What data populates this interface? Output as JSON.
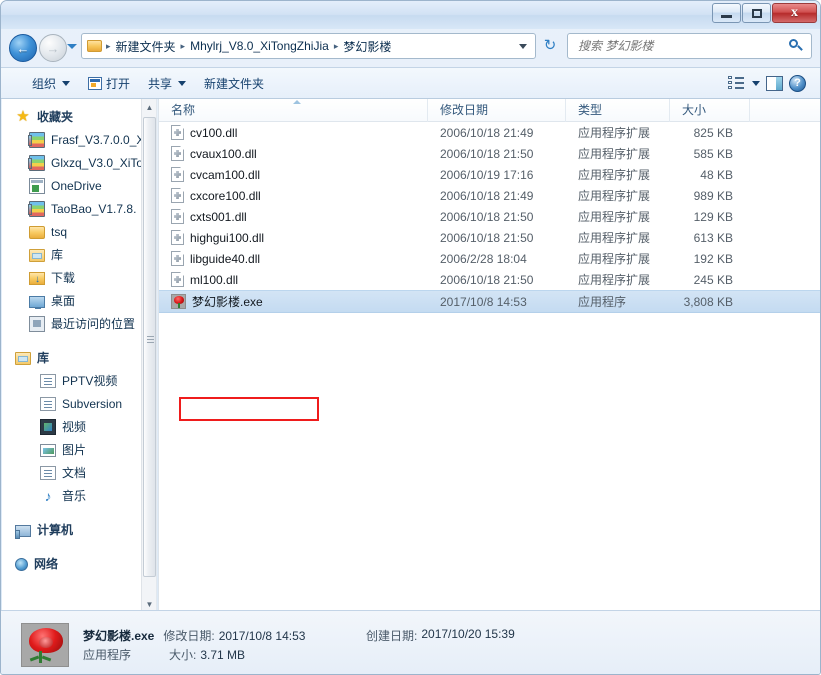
{
  "window": {
    "controls": {
      "minimize": "–",
      "maximize": "□",
      "close": "x"
    }
  },
  "nav": {
    "back_label": "←",
    "forward_label": "→",
    "refresh_label": "↻",
    "breadcrumbs": [
      "新建文件夹",
      "Mhylrj_V8.0_XiTongZhiJia",
      "梦幻影楼"
    ],
    "separator": "▸"
  },
  "search": {
    "placeholder": "搜索 梦幻影楼",
    "value": ""
  },
  "toolbar": {
    "organize": "组织",
    "open": "打开",
    "share": "共享",
    "new_folder": "新建文件夹",
    "help": "?"
  },
  "sidebar": {
    "favorites_title": "收藏夹",
    "favorites": [
      {
        "label": "Frasf_V3.7.0.0_X",
        "icon": "archive-icon"
      },
      {
        "label": "Glxzq_V3.0_XiTo",
        "icon": "archive-icon"
      },
      {
        "label": "OneDrive",
        "icon": "onedrive-icon"
      },
      {
        "label": "TaoBao_V1.7.8.",
        "icon": "archive-icon"
      },
      {
        "label": "tsq",
        "icon": "folder-icon"
      },
      {
        "label": "库",
        "icon": "library-icon"
      },
      {
        "label": "下载",
        "icon": "downloads-icon"
      },
      {
        "label": "桌面",
        "icon": "desktop-icon"
      },
      {
        "label": "最近访问的位置",
        "icon": "recent-places-icon"
      }
    ],
    "libraries_title": "库",
    "libraries": [
      {
        "label": "PPTV视频",
        "icon": "document-icon"
      },
      {
        "label": "Subversion",
        "icon": "document-icon"
      },
      {
        "label": "视频",
        "icon": "video-icon"
      },
      {
        "label": "图片",
        "icon": "picture-icon"
      },
      {
        "label": "文档",
        "icon": "document-icon"
      },
      {
        "label": "音乐",
        "icon": "music-icon"
      }
    ],
    "computer_title": "计算机",
    "network_title": "网络"
  },
  "filelist": {
    "columns": [
      "名称",
      "修改日期",
      "类型",
      "大小"
    ],
    "sorted_column": 0,
    "sort_direction": "asc",
    "rows": [
      {
        "name": "cv100.dll",
        "date": "2006/10/18 21:49",
        "type": "应用程序扩展",
        "size": "825 KB",
        "icon": "dll-icon",
        "selected": false
      },
      {
        "name": "cvaux100.dll",
        "date": "2006/10/18 21:50",
        "type": "应用程序扩展",
        "size": "585 KB",
        "icon": "dll-icon",
        "selected": false
      },
      {
        "name": "cvcam100.dll",
        "date": "2006/10/19 17:16",
        "type": "应用程序扩展",
        "size": "48 KB",
        "icon": "dll-icon",
        "selected": false
      },
      {
        "name": "cxcore100.dll",
        "date": "2006/10/18 21:49",
        "type": "应用程序扩展",
        "size": "989 KB",
        "icon": "dll-icon",
        "selected": false
      },
      {
        "name": "cxts001.dll",
        "date": "2006/10/18 21:50",
        "type": "应用程序扩展",
        "size": "129 KB",
        "icon": "dll-icon",
        "selected": false
      },
      {
        "name": "highgui100.dll",
        "date": "2006/10/18 21:50",
        "type": "应用程序扩展",
        "size": "613 KB",
        "icon": "dll-icon",
        "selected": false
      },
      {
        "name": "libguide40.dll",
        "date": "2006/2/28 18:04",
        "type": "应用程序扩展",
        "size": "192 KB",
        "icon": "dll-icon",
        "selected": false
      },
      {
        "name": "ml100.dll",
        "date": "2006/10/18 21:50",
        "type": "应用程序扩展",
        "size": "245 KB",
        "icon": "dll-icon",
        "selected": false
      },
      {
        "name": "梦幻影楼.exe",
        "date": "2017/10/8 14:53",
        "type": "应用程序",
        "size": "3,808 KB",
        "icon": "rose-app-icon",
        "selected": true
      }
    ],
    "highlight_color": "#ef1c1c"
  },
  "details": {
    "filename": "梦幻影楼.exe",
    "modified_label": "修改日期:",
    "modified_value": "2017/10/8 14:53",
    "created_label": "创建日期:",
    "created_value": "2017/10/20 15:39",
    "type": "应用程序",
    "size_label": "大小:",
    "size_value": "3.71 MB"
  }
}
